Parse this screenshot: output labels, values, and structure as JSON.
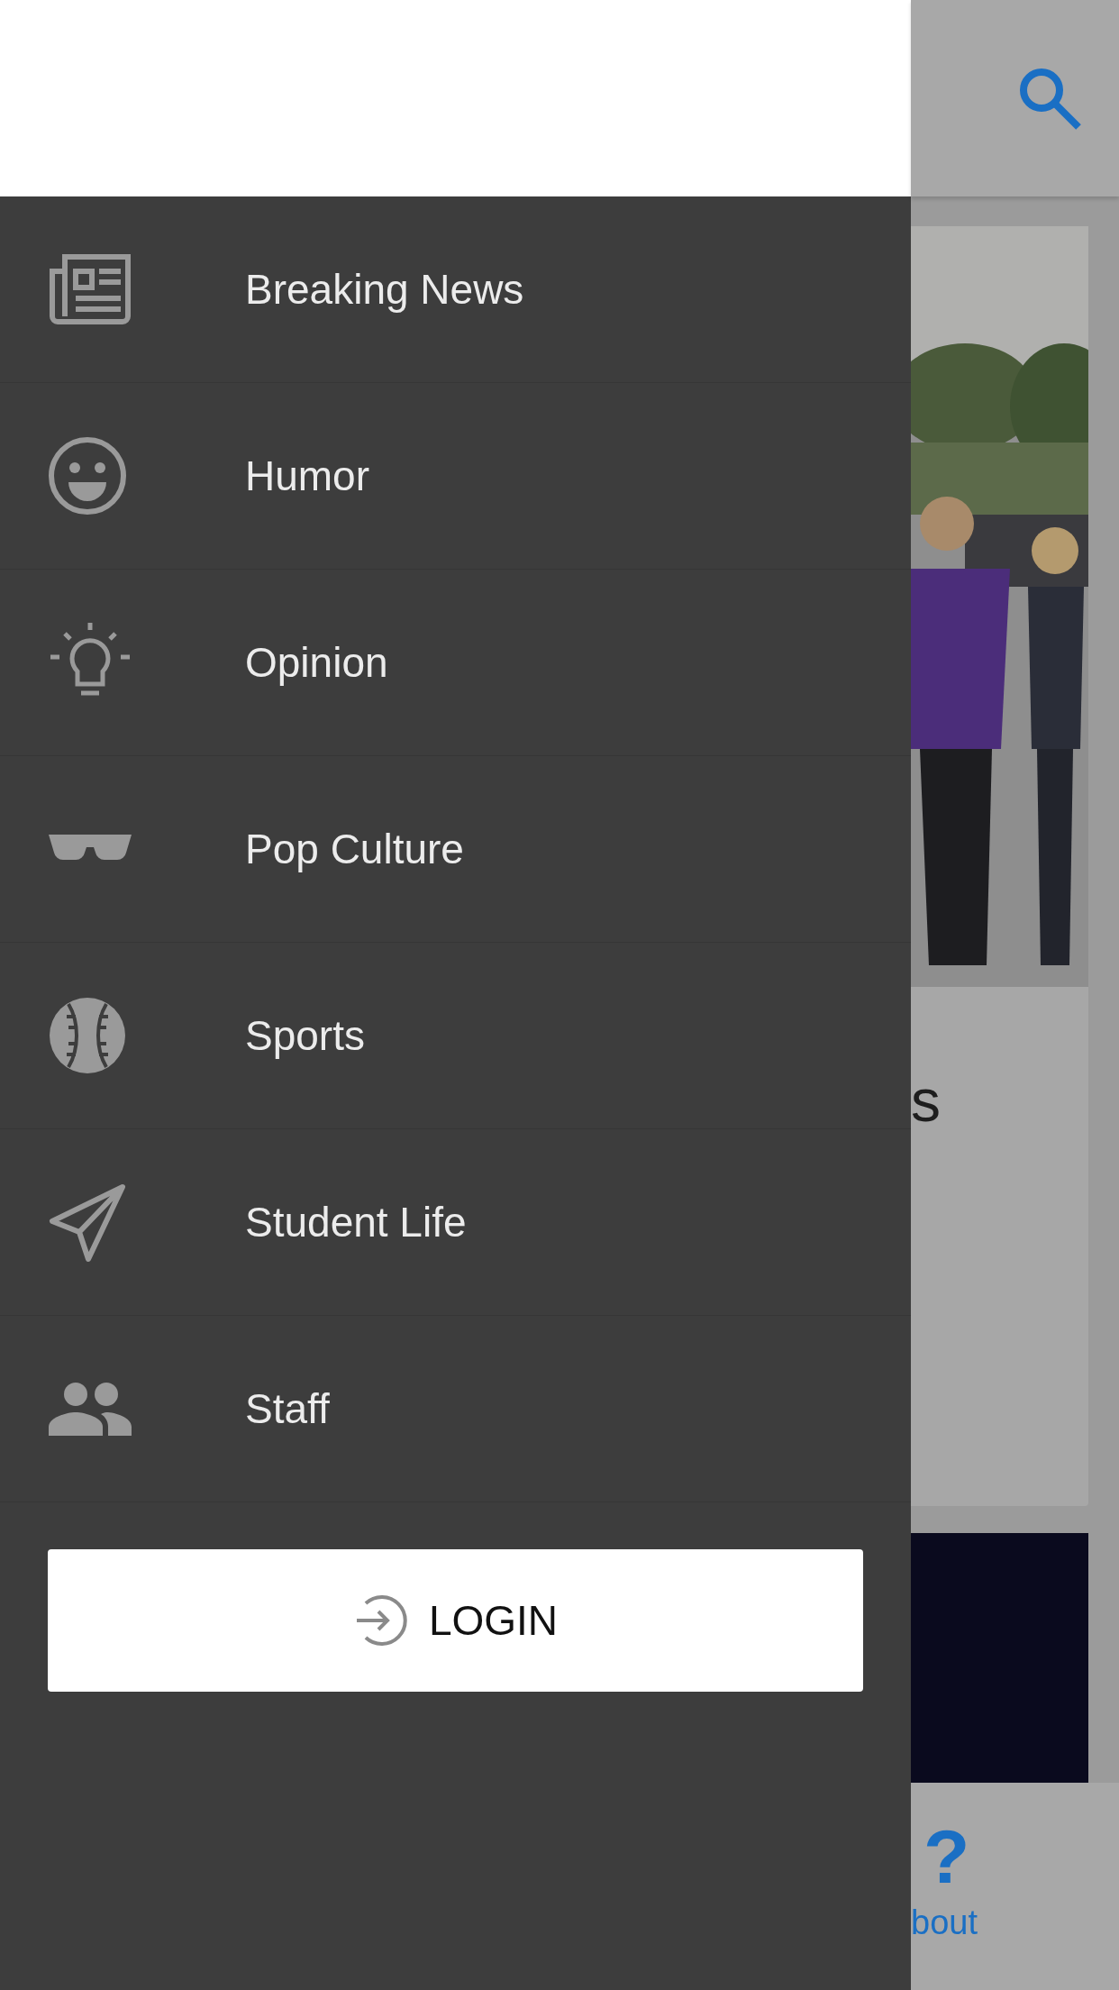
{
  "drawer": {
    "items": [
      {
        "label": "Breaking News",
        "kind": "newspaper"
      },
      {
        "label": "Humor",
        "kind": "smiley"
      },
      {
        "label": "Opinion",
        "kind": "bulb"
      },
      {
        "label": "Pop Culture",
        "kind": "sunglasses"
      },
      {
        "label": "Sports",
        "kind": "baseball"
      },
      {
        "label": "Student Life",
        "kind": "plane"
      },
      {
        "label": "Staff",
        "kind": "people"
      }
    ],
    "login_button": {
      "label": "LOGIN"
    }
  },
  "background": {
    "card_title": "s",
    "bottom_nav": {
      "icon_text": "?",
      "label": "bout"
    }
  }
}
